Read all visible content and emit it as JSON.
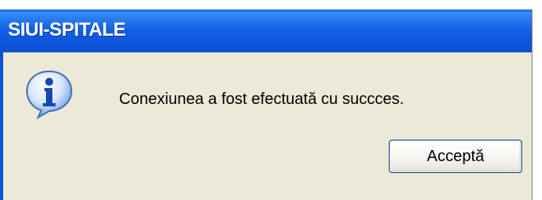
{
  "dialog": {
    "title": "SIUI-SPITALE",
    "message": "Conexiunea a fost efectuată cu succces.",
    "icon": "information-icon",
    "ok_label": "Acceptă"
  },
  "colors": {
    "titlebar": "#0c4fd2",
    "dialog_background": "#ece9d8",
    "button_border": "#003c74"
  }
}
